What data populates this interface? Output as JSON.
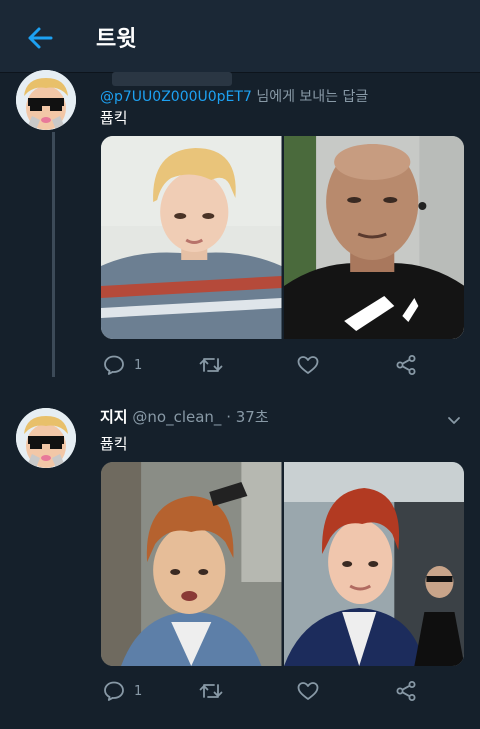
{
  "header": {
    "title": "트윗",
    "back_icon": "arrow-left-icon"
  },
  "colors": {
    "accent": "#1da1f2",
    "background": "#15202b",
    "muted": "#8899a6"
  },
  "tweet1": {
    "reply": {
      "handle": "@p7UU0Z000U0pET7",
      "suffix": "님에게 보내는 답글"
    },
    "text": "퓹킥",
    "actions": {
      "reply_count": "1"
    }
  },
  "tweet2": {
    "name": "지지",
    "handle": "@no_clean_",
    "time": "· 37초",
    "text": "퓹킥",
    "actions": {
      "reply_count": "1"
    }
  }
}
